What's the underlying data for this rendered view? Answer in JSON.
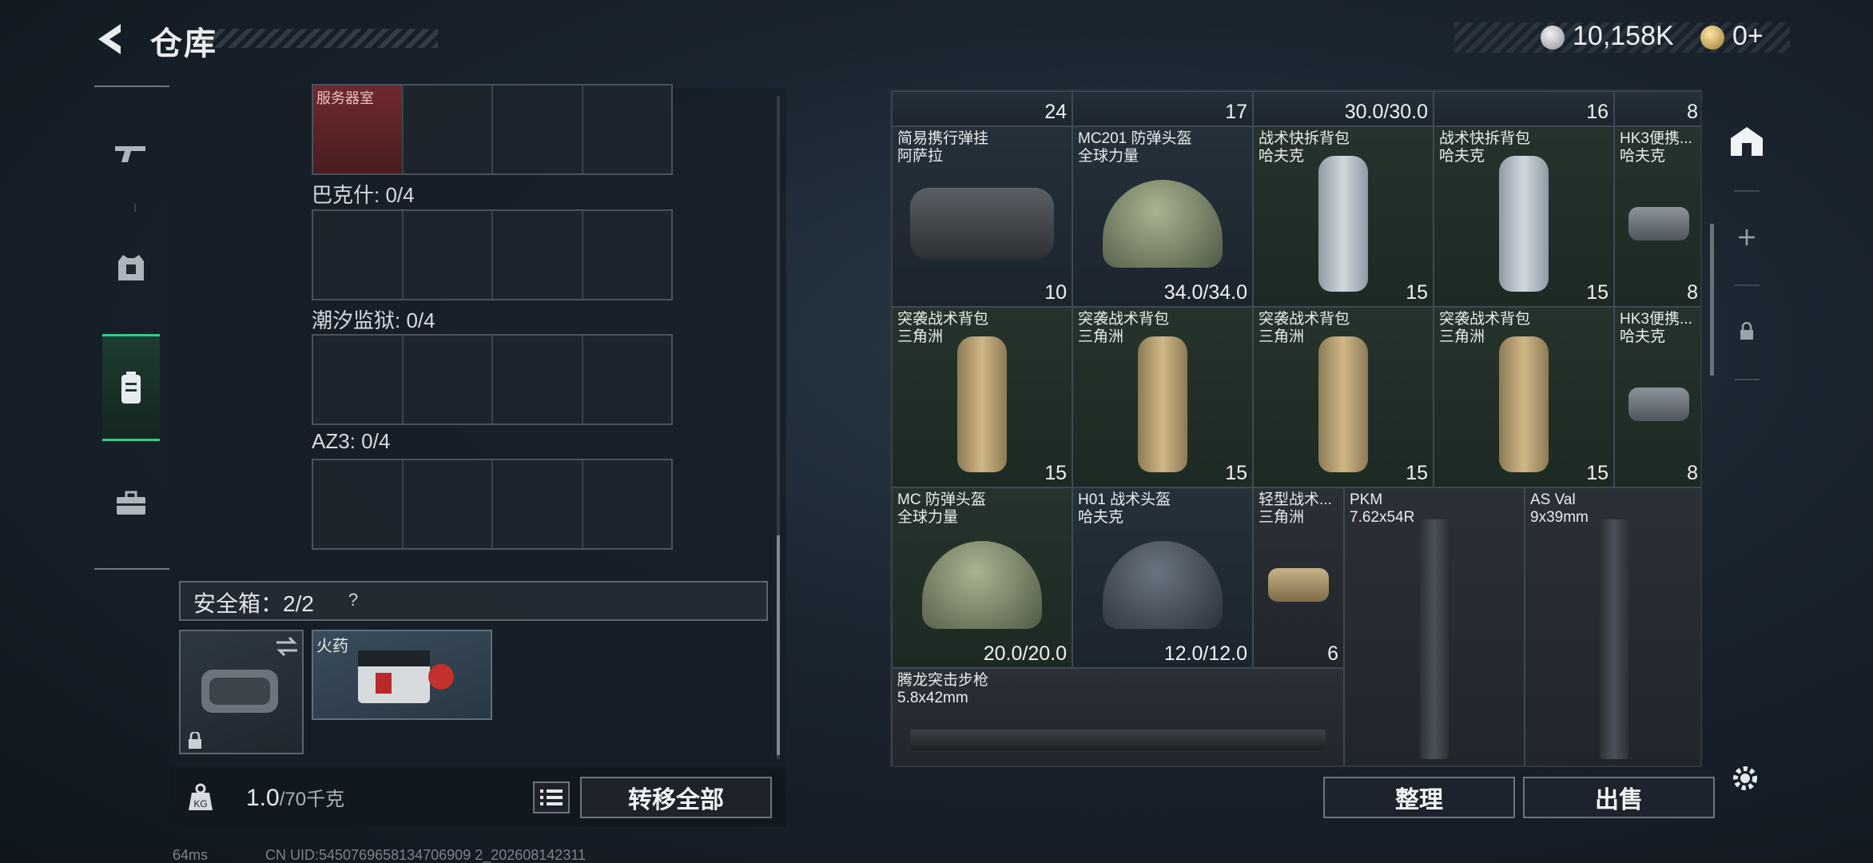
{
  "header": {
    "title": "仓库",
    "silver": "10,158K",
    "gold": "0+"
  },
  "left": {
    "service_label": "服务器室",
    "rows": [
      {
        "label": "巴克什: 0/4"
      },
      {
        "label": "潮汐监狱: 0/4"
      },
      {
        "label": "AZ3: 0/4"
      }
    ],
    "safe_box": {
      "label": "安全箱：2/2",
      "help": "?"
    },
    "item": {
      "label": "火药"
    },
    "weight": {
      "value": "1.0",
      "unit": "/70千克"
    },
    "transfer_label": "转移全部"
  },
  "stash": {
    "top_row": [
      "24",
      "17",
      "30.0/30.0",
      "16",
      "8"
    ],
    "items": [
      {
        "name": "简易携行弹挂",
        "sub": "阿萨拉",
        "val": "10"
      },
      {
        "name": "MC201 防弹头盔",
        "sub": "全球力量",
        "val": "34.0/34.0"
      },
      {
        "name": "战术快拆背包",
        "sub": "哈夫克",
        "val": "15"
      },
      {
        "name": "战术快拆背包",
        "sub": "哈夫克",
        "val": "15"
      },
      {
        "name": "HK3便携...",
        "sub": "哈夫克",
        "val": "8"
      },
      {
        "name": "突袭战术背包",
        "sub": "三角洲",
        "val": "15"
      },
      {
        "name": "突袭战术背包",
        "sub": "三角洲",
        "val": "15"
      },
      {
        "name": "突袭战术背包",
        "sub": "三角洲",
        "val": "15"
      },
      {
        "name": "突袭战术背包",
        "sub": "三角洲",
        "val": "15"
      },
      {
        "name": "HK3便携...",
        "sub": "哈夫克",
        "val": "8"
      },
      {
        "name": "MC 防弹头盔",
        "sub": "全球力量",
        "val": "20.0/20.0"
      },
      {
        "name": "H01 战术头盔",
        "sub": "哈夫克",
        "val": "12.0/12.0"
      },
      {
        "name": "轻型战术...",
        "sub": "三角洲",
        "val": "6"
      },
      {
        "name": "PKM",
        "sub": "7.62x54R",
        "val": ""
      },
      {
        "name": "AS Val",
        "sub": "9x39mm",
        "val": ""
      },
      {
        "name": "腾龙突击步枪",
        "sub": "5.8x42mm",
        "val": ""
      }
    ],
    "organize_label": "整理",
    "sell_label": "出售"
  },
  "status": {
    "ping": "64ms",
    "uid": "CN UID:5450769658134706909 2_202608142311"
  }
}
